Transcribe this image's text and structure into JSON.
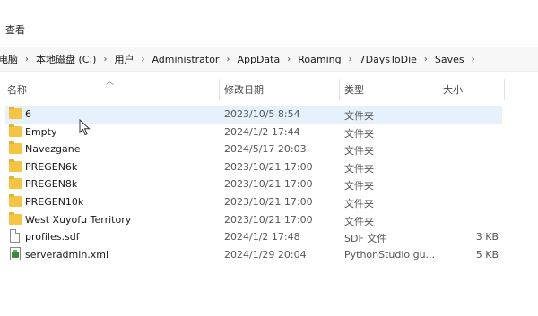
{
  "menu": {
    "view_label": "查看"
  },
  "address": {
    "crumbs": [
      "电脑",
      "本地磁盘 (C:)",
      "用户",
      "Administrator",
      "AppData",
      "Roaming",
      "7DaysToDie",
      "Saves"
    ]
  },
  "columns": {
    "name": "名称",
    "date": "修改日期",
    "type": "类型",
    "size": "大小"
  },
  "files": [
    {
      "name": "6",
      "date": "2023/10/5 8:54",
      "type": "文件夹",
      "size": "",
      "icon": "folder-icon",
      "selected": true
    },
    {
      "name": "Empty",
      "date": "2024/1/2 17:44",
      "type": "文件夹",
      "size": "",
      "icon": "folder-icon"
    },
    {
      "name": "Navezgane",
      "date": "2024/5/17 20:03",
      "type": "文件夹",
      "size": "",
      "icon": "folder-icon"
    },
    {
      "name": "PREGEN6k",
      "date": "2023/10/21 17:00",
      "type": "文件夹",
      "size": "",
      "icon": "folder-icon"
    },
    {
      "name": "PREGEN8k",
      "date": "2023/10/21 17:00",
      "type": "文件夹",
      "size": "",
      "icon": "folder-icon"
    },
    {
      "name": "PREGEN10k",
      "date": "2023/10/21 17:00",
      "type": "文件夹",
      "size": "",
      "icon": "folder-icon"
    },
    {
      "name": "West Xuyofu Territory",
      "date": "2023/10/21 17:00",
      "type": "文件夹",
      "size": "",
      "icon": "folder-icon"
    },
    {
      "name": "profiles.sdf",
      "date": "2024/1/2 17:48",
      "type": "SDF 文件",
      "size": "3 KB",
      "icon": "file-icon"
    },
    {
      "name": "serveradmin.xml",
      "date": "2024/1/29 20:04",
      "type": "PythonStudio gu...",
      "size": "5 KB",
      "icon": "xml-icon"
    }
  ]
}
